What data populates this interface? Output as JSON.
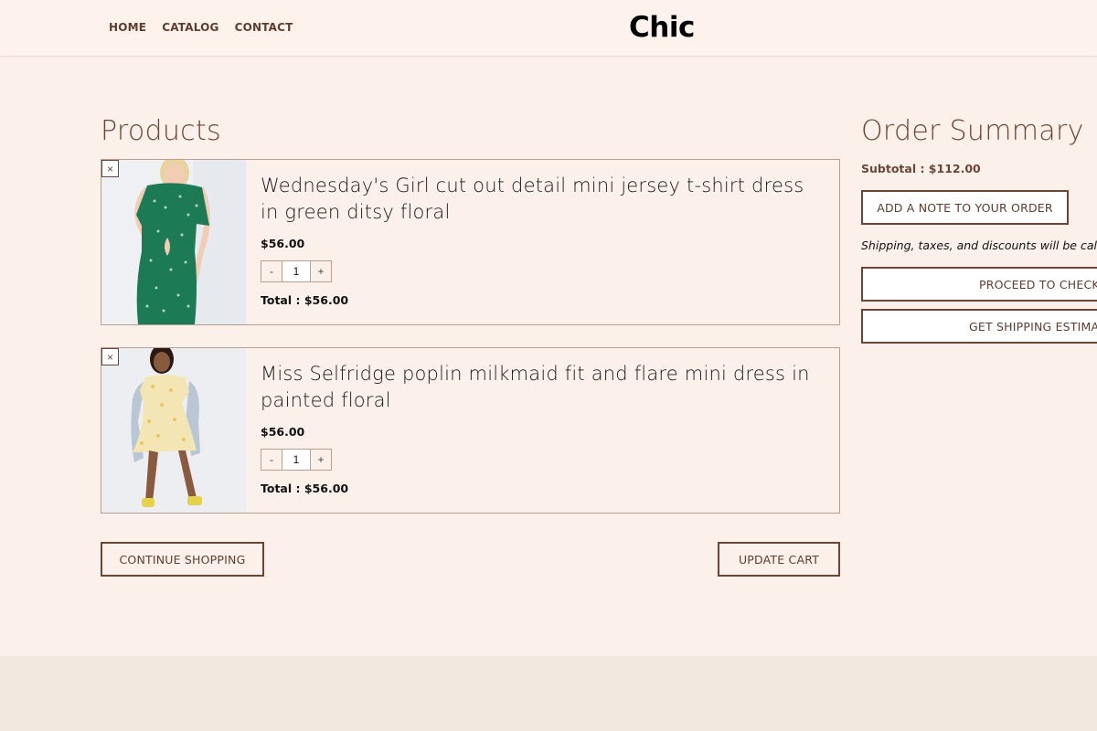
{
  "header": {
    "nav": [
      "HOME",
      "CATALOG",
      "CONTACT"
    ],
    "logo": "Chic"
  },
  "products": {
    "title": "Products",
    "items": [
      {
        "remove_glyph": "×",
        "name": "Wednesday's Girl cut out detail mini jersey t-shirt dress in green ditsy floral",
        "price": "$56.00",
        "quantity": "1",
        "minus": "-",
        "plus": "+",
        "total": "Total : $56.00",
        "image": "green-floral-dress-photo"
      },
      {
        "remove_glyph": "×",
        "name": "Miss Selfridge poplin milkmaid fit and flare mini dress in painted floral",
        "price": "$56.00",
        "quantity": "1",
        "minus": "-",
        "plus": "+",
        "total": "Total : $56.00",
        "image": "yellow-floral-dress-photo"
      }
    ],
    "continue_label": "CONTINUE SHOPPING",
    "update_label": "UPDATE CART"
  },
  "summary": {
    "title": "Order Summary",
    "subtotal": "Subtotal : $112.00",
    "note_label": "ADD A NOTE TO YOUR ORDER",
    "shipping_text": "Shipping, taxes, and discounts will be cal",
    "checkout_label": "PROCEED TO CHECKO",
    "estimate_label": "GET SHIPPING ESTIMATE"
  },
  "colors": {
    "background": "#fbf0ea",
    "accent": "#6b4637",
    "footer": "#f3e8df"
  }
}
